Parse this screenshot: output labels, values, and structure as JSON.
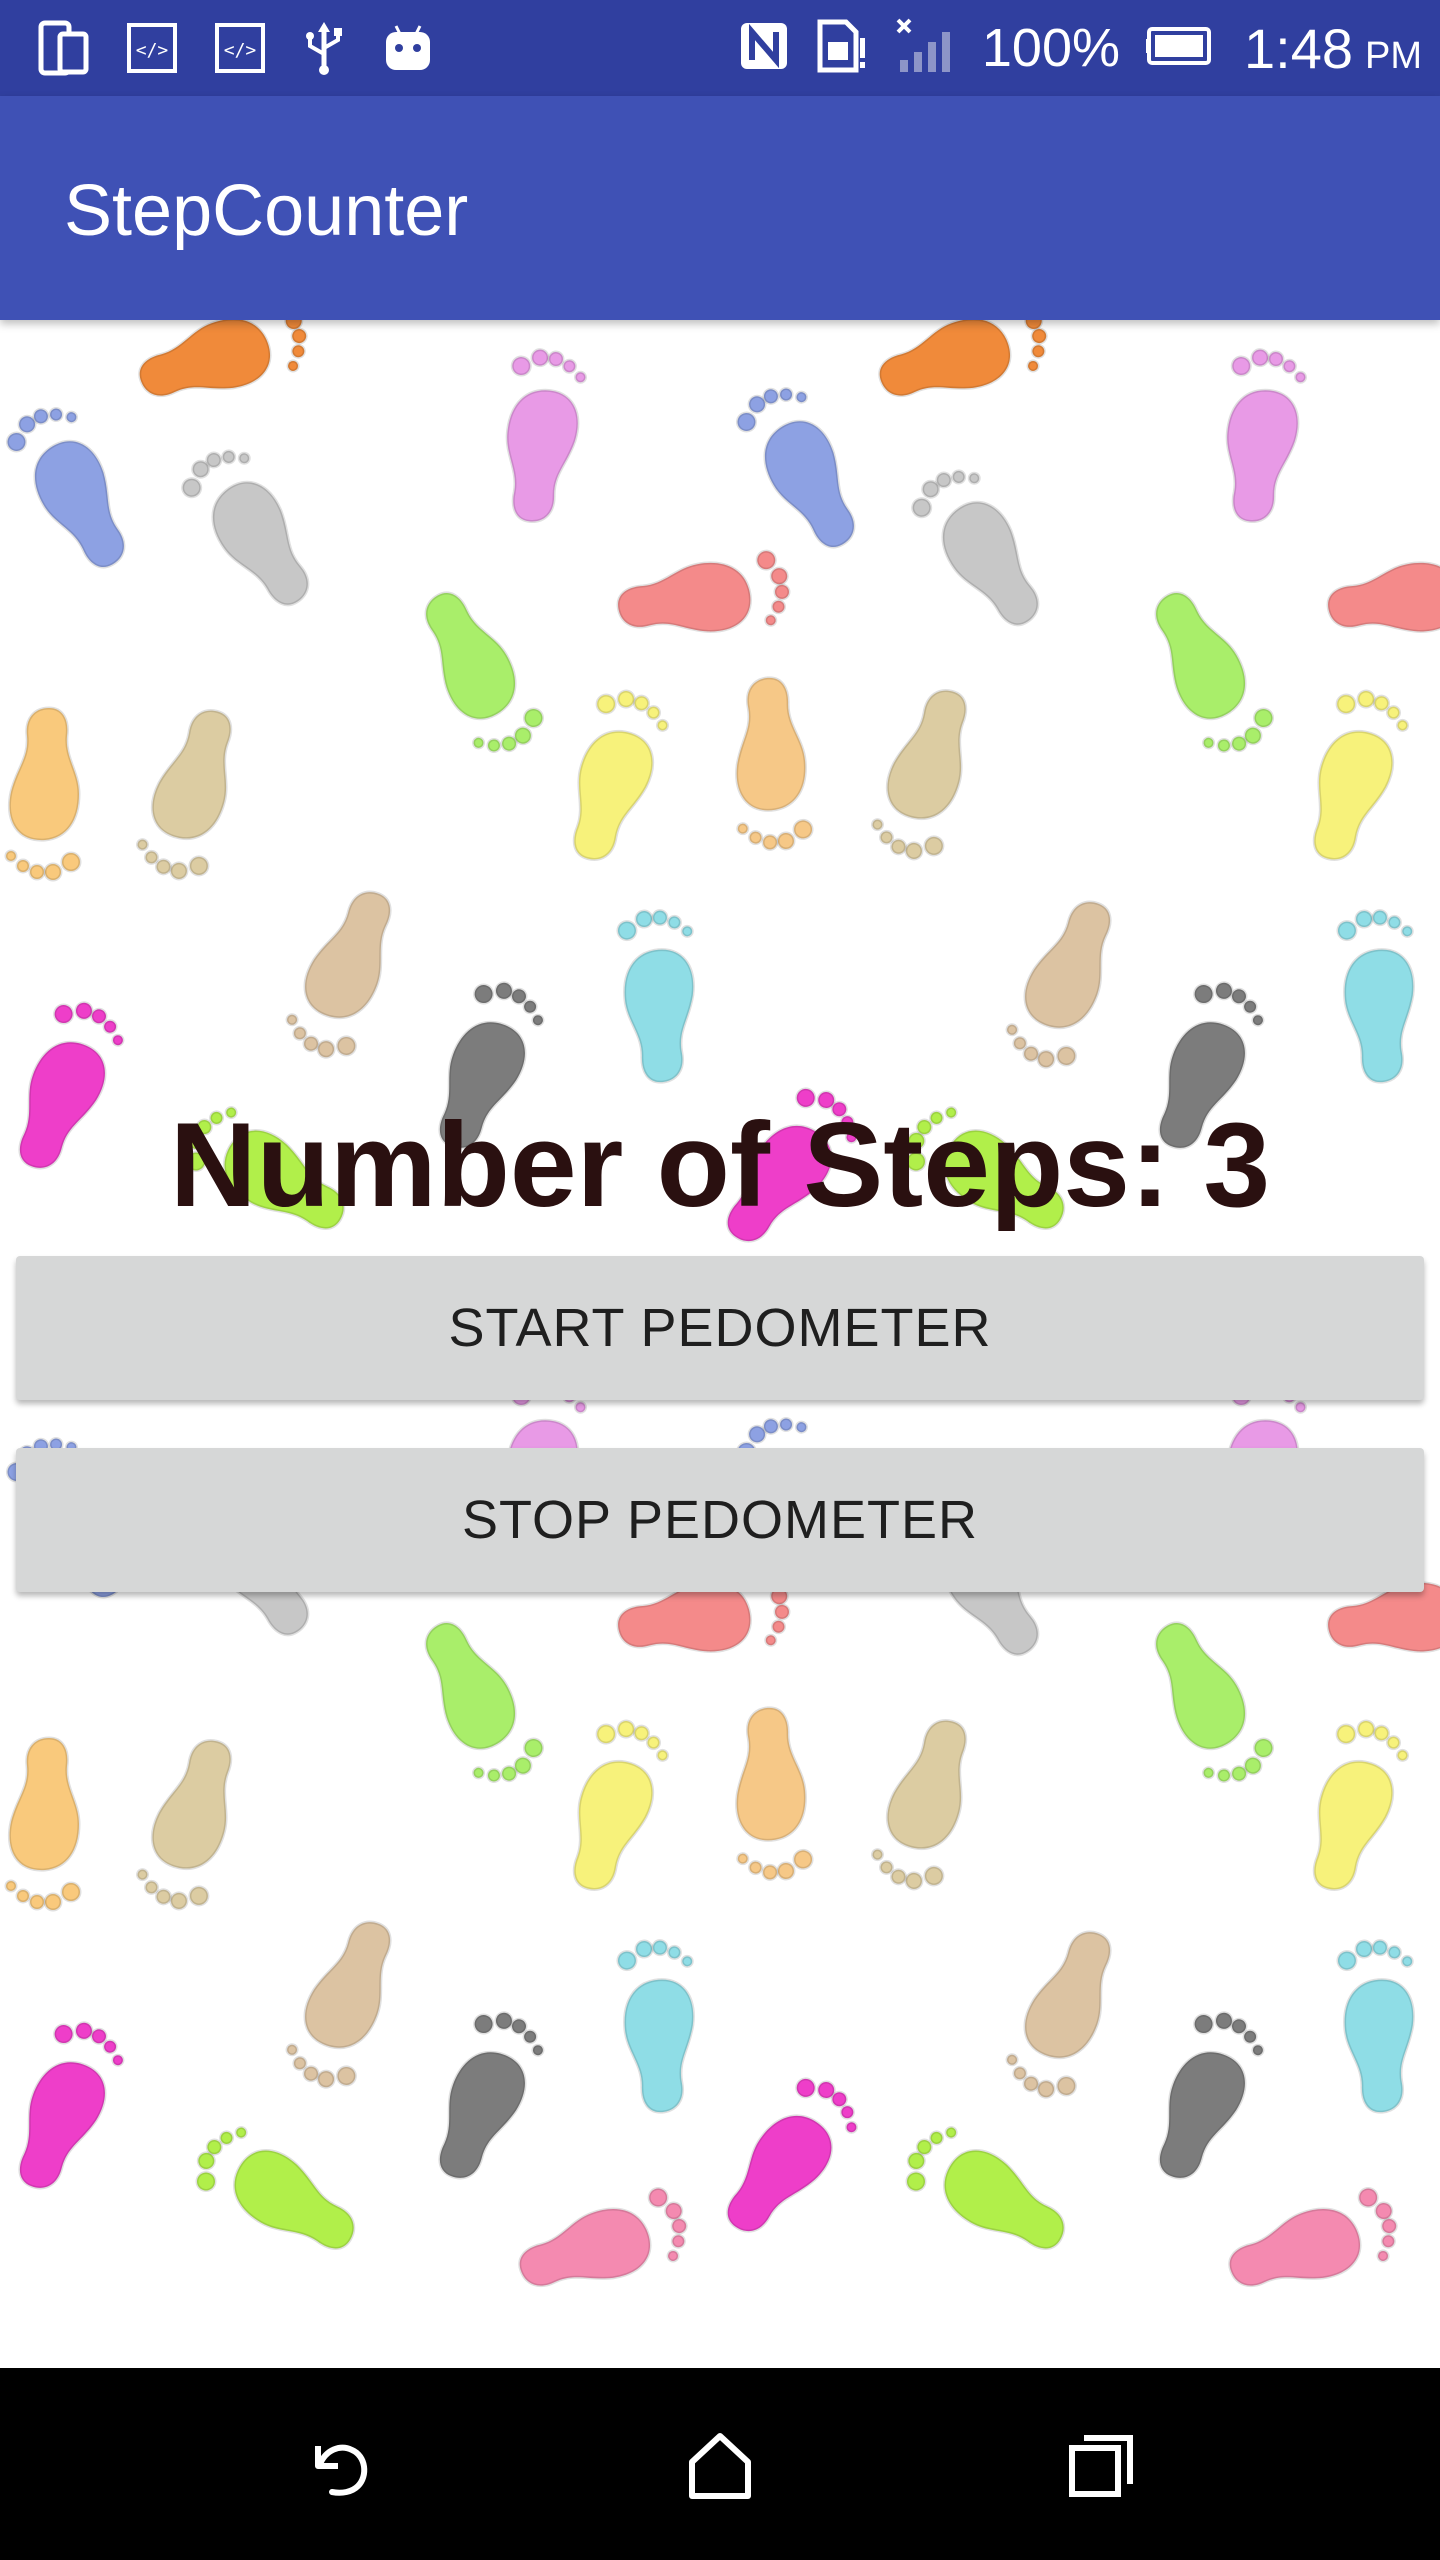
{
  "status_bar": {
    "left_icons": [
      "device-icon",
      "code-icon",
      "code-icon",
      "usb-icon",
      "android-icon"
    ],
    "right_icons": [
      "nfc-icon",
      "sim-icon",
      "signal-icon",
      "battery-icon"
    ],
    "battery_percent": "100%",
    "time": "1:48",
    "ampm": "PM"
  },
  "app_bar": {
    "title": "StepCounter"
  },
  "main": {
    "steps_label": "Number of Steps: 3",
    "start_button": "START PEDOMETER",
    "stop_button": "STOP PEDOMETER"
  },
  "nav_bar": {
    "icons": [
      "back-icon",
      "home-icon",
      "recents-icon"
    ]
  },
  "colors": {
    "status_bar": "#303f9f",
    "app_bar": "#3f51b5",
    "button_bg": "#d6d7d7",
    "steps_text": "#2a1010"
  }
}
